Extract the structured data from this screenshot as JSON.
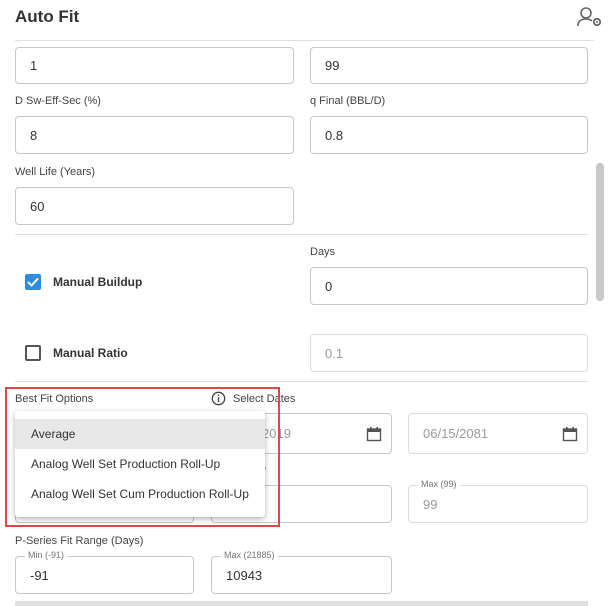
{
  "header": {
    "title": "Auto Fit"
  },
  "fields": {
    "top_left_value": "1",
    "top_right_value": "99",
    "d_sw_eff_sec": {
      "label": "D Sw-Eff-Sec (%)",
      "value": "8"
    },
    "q_final": {
      "label": "q Final (BBL/D)",
      "value": "0.8"
    },
    "well_life": {
      "label": "Well Life (Years)",
      "value": "60"
    },
    "days": {
      "label": "Days",
      "value": "0"
    }
  },
  "manual_buildup": {
    "label": "Manual Buildup",
    "checked": true
  },
  "manual_ratio": {
    "label": "Manual Ratio",
    "checked": false,
    "value": "0.1"
  },
  "best_fit": {
    "label": "Best Fit Options",
    "select_dates_label": "Select Dates",
    "options": [
      "Average",
      "Analog Well Set Production Roll-Up",
      "Analog Well Set Cum Production Roll-Up"
    ],
    "selected": "Average"
  },
  "dates": {
    "start_partial": "2019",
    "end": "06/15/2081"
  },
  "partial_label": "e",
  "range_row": {
    "max_label": "Max (99)",
    "max_value": "99"
  },
  "p_series": {
    "label": "P-Series Fit Range (Days)",
    "min_label": "Min (-91)",
    "min_value": "-91",
    "max_label": "Max (21885)",
    "max_value": "10943"
  },
  "colors": {
    "accent": "#2d8ddf",
    "highlight": "#e04848"
  }
}
